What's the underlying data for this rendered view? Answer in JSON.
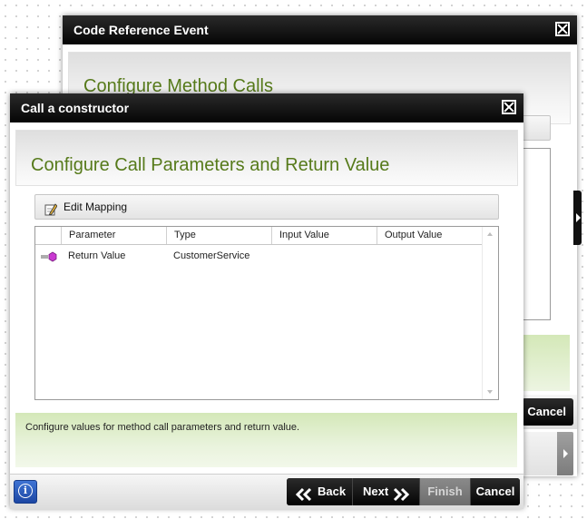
{
  "back_dialog": {
    "title": "Code Reference Event",
    "heading": "Configure Method Calls",
    "cancel_label": "Cancel"
  },
  "front_dialog": {
    "title": "Call a constructor",
    "heading": "Configure Call Parameters and Return Value",
    "toolbar": {
      "edit_mapping_label": "Edit Mapping",
      "edit_icon": "pencil-edit-icon"
    },
    "grid": {
      "columns": [
        "Parameter",
        "Type",
        "Input Value",
        "Output Value"
      ],
      "rows": [
        {
          "parameter": "Return Value",
          "type": "CustomerService",
          "input_value": "",
          "output_value": "",
          "icon": "return-value-icon"
        }
      ]
    },
    "info_text": "Configure values for method call parameters and return value.",
    "footer": {
      "info_icon": "info-icon",
      "back_label": "Back",
      "next_label": "Next",
      "finish_label": "Finish",
      "cancel_label": "Cancel"
    }
  },
  "colors": {
    "heading_green": "#567a1a",
    "info_blue": "#2a57b8"
  }
}
